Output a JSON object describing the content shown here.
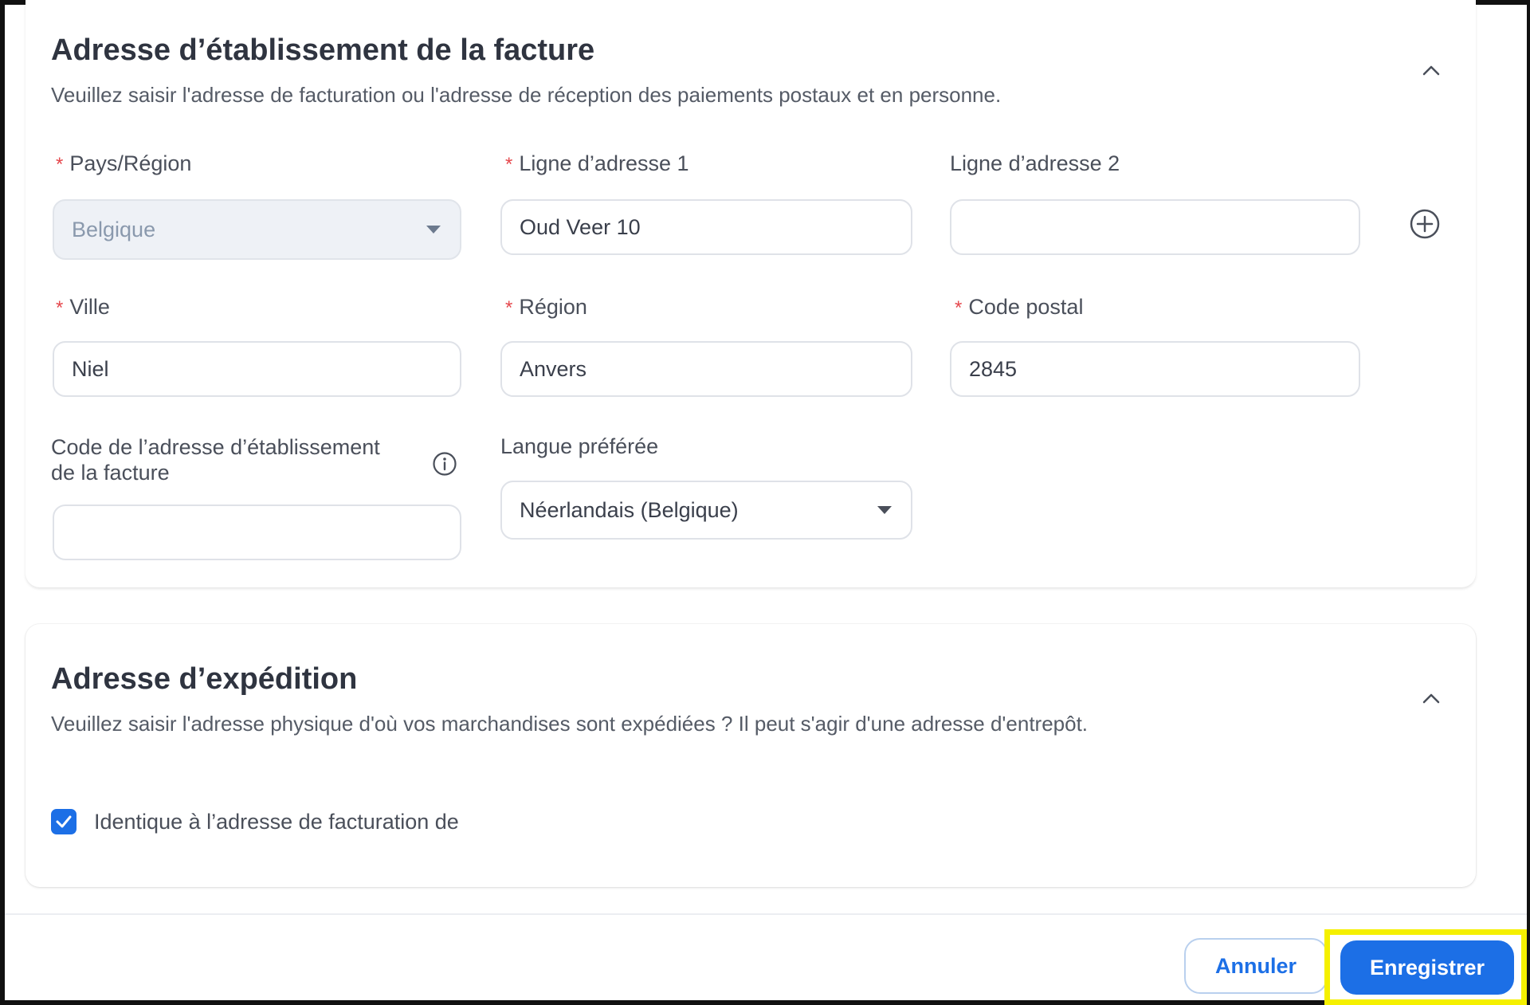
{
  "billing": {
    "title": "Adresse d’établissement de la facture",
    "subtitle": "Veuillez saisir l'adresse de facturation ou l'adresse de réception des paiements postaux et en personne.",
    "required_mark": "*",
    "fields": {
      "country": {
        "label": "Pays/Région",
        "value": "Belgique",
        "required": true,
        "disabled": true
      },
      "address1": {
        "label": "Ligne d’adresse 1",
        "value": "Oud Veer 10",
        "required": true
      },
      "address2": {
        "label": "Ligne d’adresse 2",
        "value": "",
        "required": false
      },
      "city": {
        "label": "Ville",
        "value": "Niel",
        "required": true
      },
      "region": {
        "label": "Région",
        "value": "Anvers",
        "required": true
      },
      "postal": {
        "label": "Code postal",
        "value": "2845",
        "required": true
      },
      "address_code": {
        "label": "Code de l’adresse d’établissement de la facture",
        "value": "",
        "required": false
      },
      "language": {
        "label": "Langue préférée",
        "value": "Néerlandais (Belgique)",
        "required": false
      }
    }
  },
  "shipping": {
    "title": "Adresse d’expédition",
    "subtitle": "Veuillez saisir l'adresse physique d'où vos marchandises sont expédiées ? Il peut s'agir d'une adresse d'entrepôt.",
    "same_as_billing": {
      "label": "Identique à l’adresse de facturation de",
      "checked": true
    }
  },
  "footer": {
    "cancel_label": "Annuler",
    "save_label": "Enregistrer"
  },
  "icons": {
    "collapse": "chevron-up-icon",
    "add": "plus-circle-icon",
    "info": "info-icon",
    "dropdown": "caret-down-icon",
    "check": "check-icon"
  },
  "colors": {
    "accent": "#1c6fe6",
    "required": "#e5484d",
    "highlight": "#f5f000"
  }
}
